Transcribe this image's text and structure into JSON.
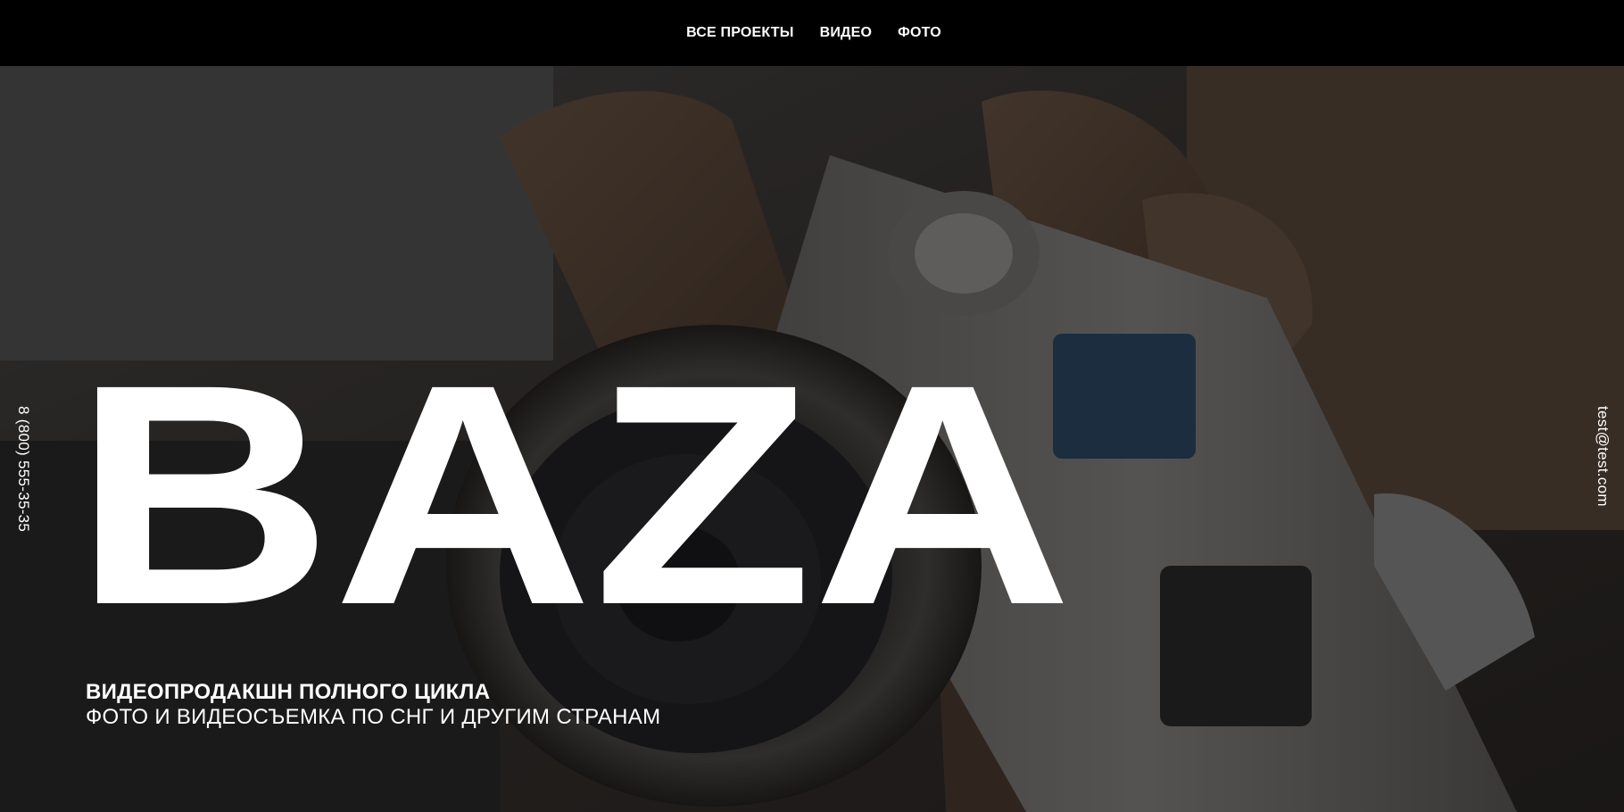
{
  "nav": {
    "items": [
      {
        "label": "ВСЕ ПРОЕКТЫ"
      },
      {
        "label": "ВИДЕО"
      },
      {
        "label": "ФОТО"
      }
    ]
  },
  "hero": {
    "brand_title": "BAZA",
    "tagline_primary": "ВИДЕОПРОДАКШН ПОЛНОГО ЦИКЛА",
    "tagline_secondary": "ФОТО И ВИДЕОСЪЕМКА ПО СНГ И ДРУГИМ СТРАНАМ",
    "background": "camera-photo"
  },
  "contacts": {
    "phone": "8 (800) 555-35-35",
    "email": "test@test.com"
  },
  "colors": {
    "nav_bg": "#000000",
    "text": "#ffffff"
  }
}
